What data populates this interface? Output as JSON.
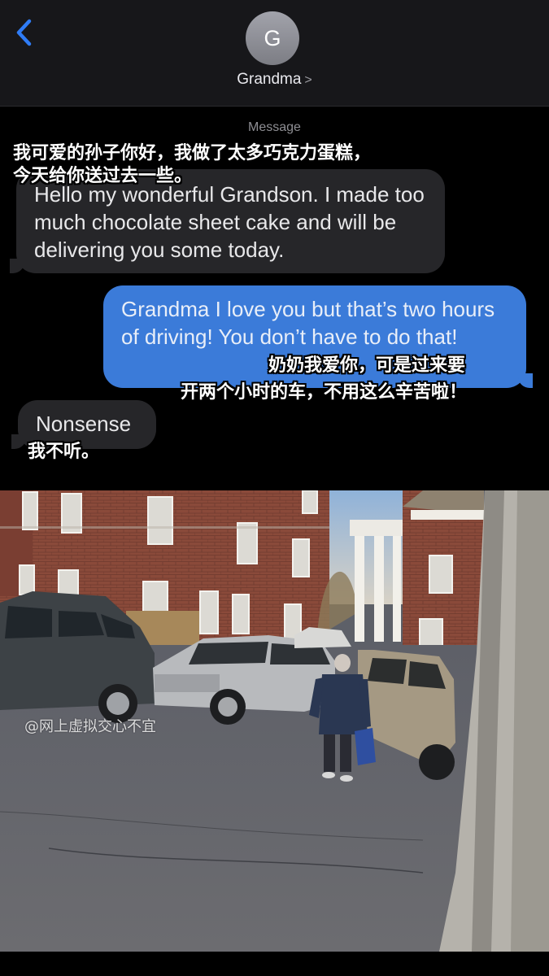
{
  "header": {
    "contact_initial": "G",
    "contact_name": "Grandma",
    "contact_chevron": ">",
    "back_icon": "chevron-left-icon"
  },
  "thread": {
    "timestamp_label": "Message",
    "messages": [
      {
        "direction": "received",
        "text": "Hello my wonderful Grandson. I made too much chocolate sheet cake and will be delivering you some today."
      },
      {
        "direction": "sent",
        "text": "Grandma I love you but that’s two hours of driving! You don’t have to do that!"
      },
      {
        "direction": "received",
        "text": "Nonsense"
      }
    ]
  },
  "overlays": {
    "caption_1": "我可爱的孙子你好，我做了太多巧克力蛋糕，\n今天给你送过去一些。",
    "caption_2_line1": "奶奶我爱你，可是过来要",
    "caption_2_line2": "开两个小时的车，不用这么辛苦啦！",
    "caption_3": "我不听。"
  },
  "photo": {
    "watermark": "@网上虚拟交心不宜"
  },
  "colors": {
    "sent_bubble": "#3b7bd9",
    "received_bubble": "#262629",
    "header_bg": "#17171a",
    "accent": "#2f7cf6"
  }
}
